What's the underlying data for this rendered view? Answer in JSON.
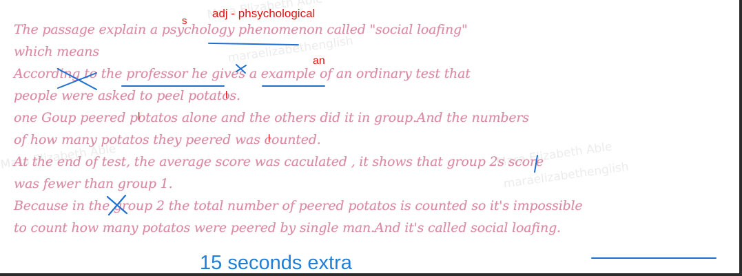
{
  "essay": {
    "lines": [
      "The passage explain a psychology phenomenon called \"social loafing\"",
      "which means",
      "According to the professor he gives a example of an ordinary test that",
      "people were asked to peel potatos.",
      "one Goup  peered potatos alone and the others did it in group.And the numbers",
      "of how many potatos they peered was counted.",
      "At the end of test, the average score was caculated , it shows that group 2s score",
      "was fewer than group 1.",
      "Because in the group 2 the total number of peered potatos is counted so it's impossible",
      "to count how many potatos were peered by single man.And it's called social loafing."
    ]
  },
  "corrections": {
    "plural_s": "s",
    "adj_note": "adj - phsychological",
    "article_an": "an",
    "l_mark_1": "l",
    "l_mark_2": "l",
    "l_mark_3": "l"
  },
  "watermark": {
    "text_1": "Mara Elizabeth Able",
    "text_2": "maraelizabethenglish"
  },
  "footer": {
    "note": "15 seconds extra"
  },
  "colors": {
    "essay_text": "#d98aa4",
    "correction_red": "#e01010",
    "annotation_blue": "#1e6fd1",
    "footer_blue": "#1f7fd6"
  }
}
